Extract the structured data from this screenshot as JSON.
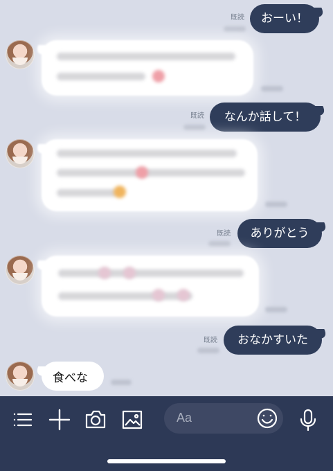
{
  "read_label": "既読",
  "messages": {
    "m1": "おーい！",
    "m2": "なんか話して！",
    "m3": "ありがとう",
    "m4": "おなかすいた",
    "m5": "食べな"
  },
  "composer": {
    "placeholder": "Aa"
  },
  "icons": {
    "menu": "menu-icon",
    "add": "plus-icon",
    "camera": "camera-icon",
    "image": "image-icon",
    "emoji": "emoji-icon",
    "mic": "microphone-icon"
  },
  "colors": {
    "chat_background": "#d8dce8",
    "outgoing_bubble": "#2f3d5a",
    "toolbar": "#2d3956"
  }
}
